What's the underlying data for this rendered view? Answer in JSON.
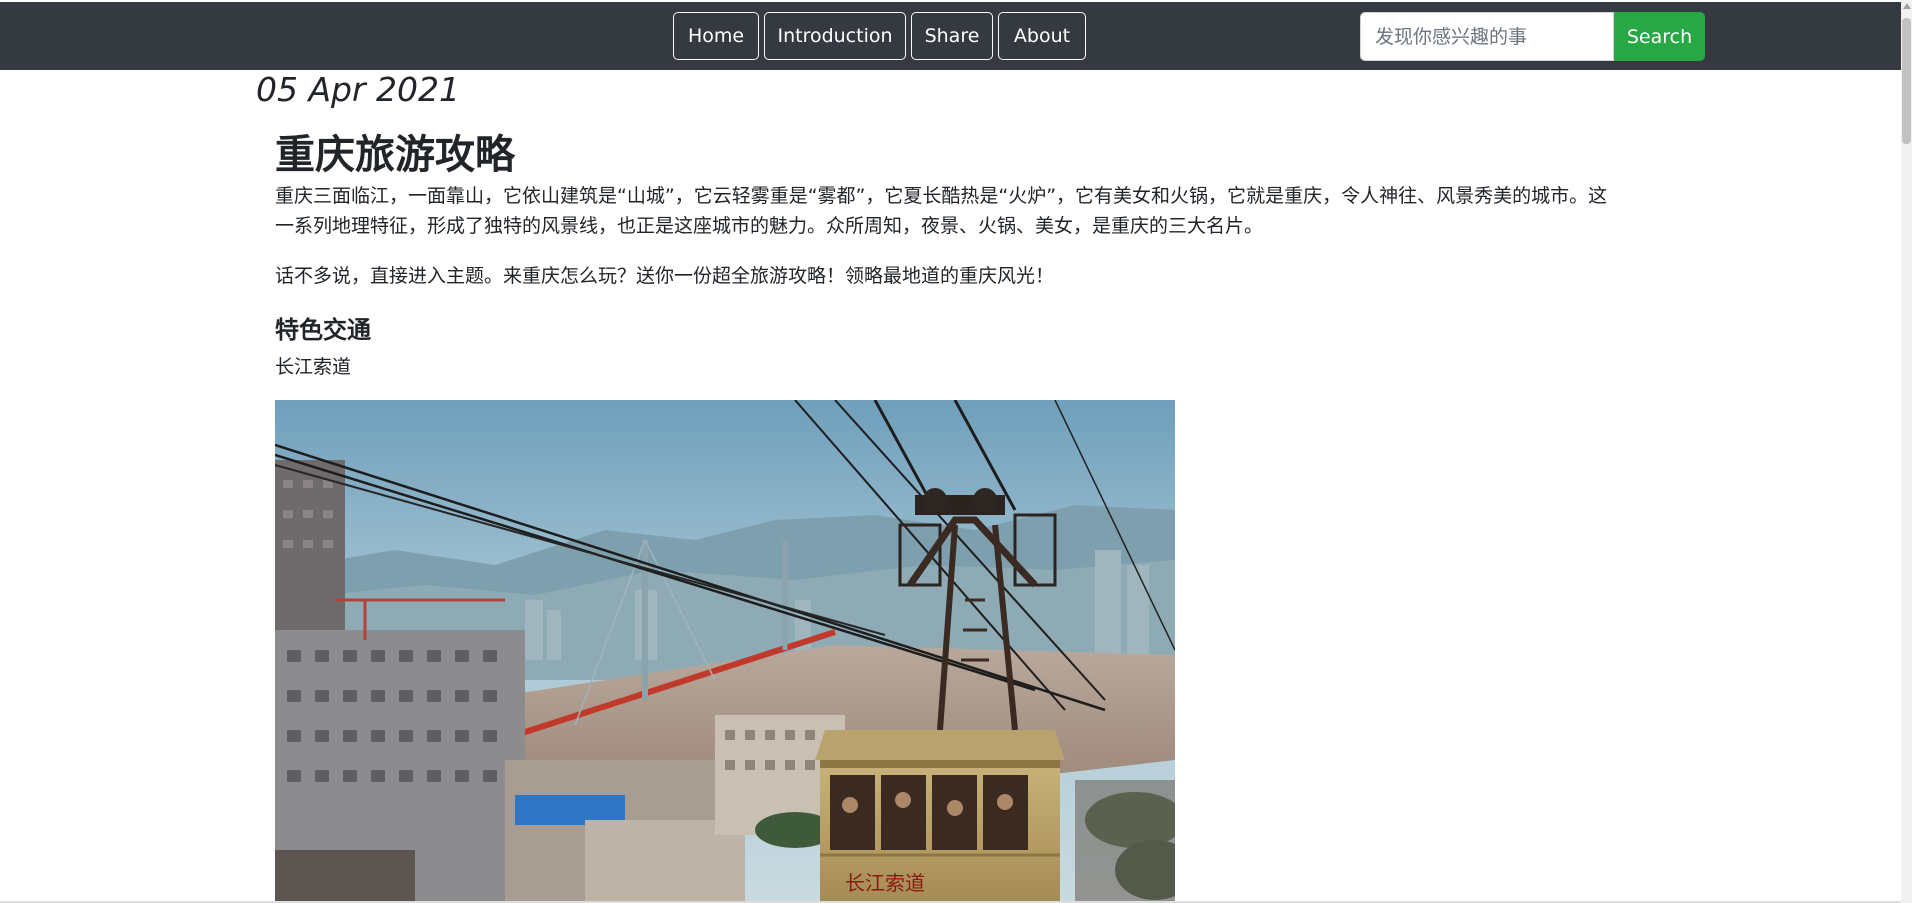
{
  "nav": {
    "items": [
      {
        "label": "Home"
      },
      {
        "label": "Introduction"
      },
      {
        "label": "Share"
      },
      {
        "label": "About"
      }
    ],
    "search": {
      "placeholder": "发现你感兴趣的事",
      "button_label": "Search"
    }
  },
  "article": {
    "date": "05 Apr 2021",
    "title": "重庆旅游攻略",
    "intro": "重庆三面临江，一面靠山，它依山建筑是“山城”，它云轻雾重是“雾都”，它夏长酷热是“火炉”，它有美女和火锅，它就是重庆，令人神往、风景秀美的城市。这一系列地理特征，形成了独特的风景线，也正是这座城市的魅力。众所周知，夜景、火锅、美女，是重庆的三大名片。",
    "lead": "话不多说，直接进入主题。来重庆怎么玩？送你一份超全旅游攻略！领略最地道的重庆风光！",
    "section_title": "特色交通",
    "item_title": "长江索道",
    "photo_sign_text": "长江索道"
  },
  "colors": {
    "navbar_bg": "#343a40",
    "search_button_bg": "#28a745",
    "text": "#212529"
  }
}
